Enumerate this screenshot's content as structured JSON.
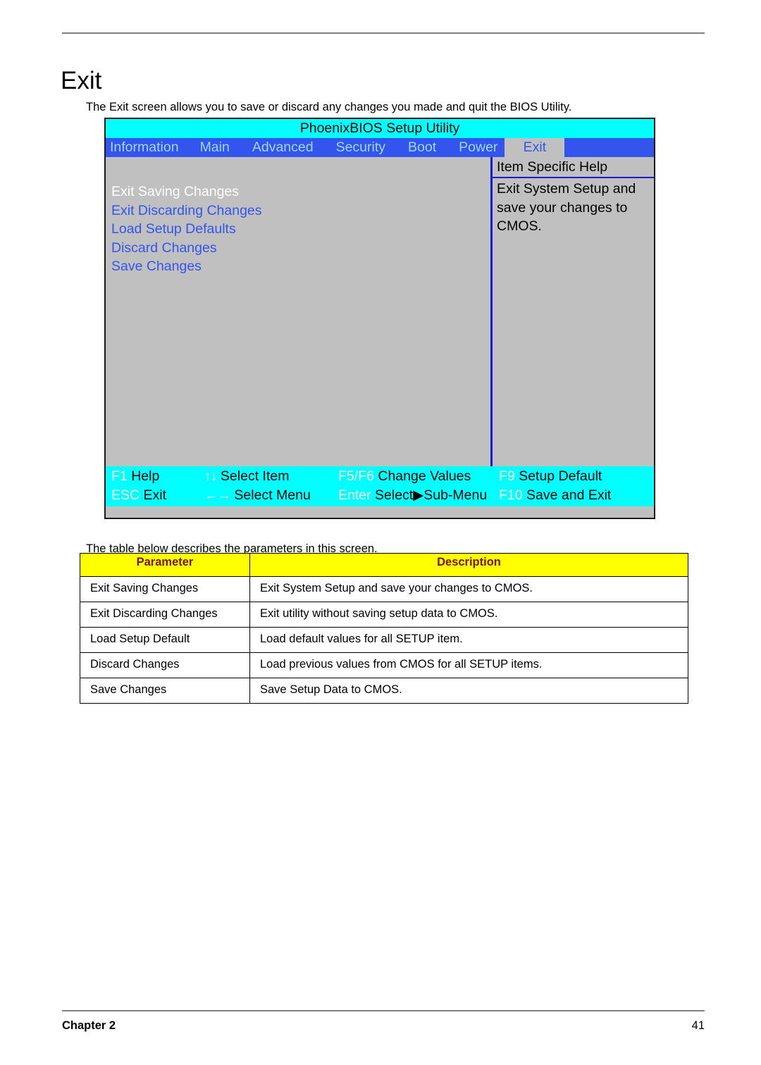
{
  "document": {
    "page_title": "Exit",
    "intro_text": "The Exit screen allows you to save or discard any changes you made and quit the BIOS Utility.",
    "table_intro": "The table below describes the parameters in this screen."
  },
  "bios": {
    "title": "PhoenixBIOS Setup Utility",
    "menu_tabs": [
      {
        "label": "Information",
        "active": false
      },
      {
        "label": "Main",
        "active": false
      },
      {
        "label": "Advanced",
        "active": false
      },
      {
        "label": "Security",
        "active": false
      },
      {
        "label": "Boot",
        "active": false
      },
      {
        "label": "Power",
        "active": false
      },
      {
        "label": "Exit",
        "active": true
      }
    ],
    "options": [
      {
        "label": "Exit Saving Changes",
        "selected": true
      },
      {
        "label": "Exit Discarding Changes",
        "selected": false
      },
      {
        "label": "Load Setup Defaults",
        "selected": false
      },
      {
        "label": "Discard Changes",
        "selected": false
      },
      {
        "label": "Save Changes",
        "selected": false
      }
    ],
    "help": {
      "title": "Item Specific Help",
      "body": "Exit System Setup and save your changes to CMOS."
    },
    "status_bar": {
      "row1": [
        {
          "key": "F1",
          "action": "Help"
        },
        {
          "key": "↑↓",
          "action": "Select Item"
        },
        {
          "key": "F5/F6",
          "action": "Change Values"
        },
        {
          "key": "F9",
          "action": "Setup Default"
        }
      ],
      "row2": [
        {
          "key": "ESC",
          "action": "Exit"
        },
        {
          "key": "←→",
          "action": "Select Menu"
        },
        {
          "key": "Enter",
          "action": "Select▶Sub-Menu"
        },
        {
          "key": "F10",
          "action": "Save and Exit"
        }
      ]
    },
    "colors": {
      "title_bar": "#00ffff",
      "menu_bar": "#3355ee",
      "panel": "#c0c0c0",
      "selected_option": "#ffffff",
      "option": "#3355ee",
      "status_bar": "#00ffff",
      "divider": "#1a1ad0"
    }
  },
  "parameter_table": {
    "headers": [
      "Parameter",
      "Description"
    ],
    "header_bg": "#ffff00",
    "header_color": "#7a1212",
    "rows": [
      {
        "parameter": "Exit Saving Changes",
        "description": "Exit System Setup and save your changes to CMOS."
      },
      {
        "parameter": "Exit Discarding Changes",
        "description": "Exit utility without saving setup data to CMOS."
      },
      {
        "parameter": "Load Setup Default",
        "description": "Load default values for all SETUP item."
      },
      {
        "parameter": "Discard Changes",
        "description": "Load previous values from CMOS for all SETUP items."
      },
      {
        "parameter": "Save Changes",
        "description": "Save Setup Data to CMOS."
      }
    ]
  },
  "footer": {
    "chapter": "Chapter 2",
    "page_number": "41"
  }
}
